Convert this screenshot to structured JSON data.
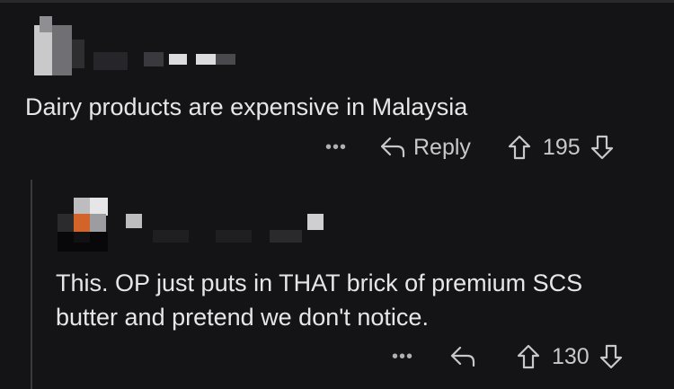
{
  "comment": {
    "body": "Dairy products are expensive in Malaysia",
    "more_label": "•••",
    "reply_label": "Reply",
    "score": "195",
    "icons": {
      "reply": "reply-arrow-icon",
      "upvote": "upvote-arrow-icon",
      "downvote": "downvote-arrow-icon"
    }
  },
  "reply": {
    "body": "This. OP just puts in THAT brick of premium SCS butter and pretend we don't notice.",
    "more_label": "•••",
    "score": "130",
    "icons": {
      "reply": "reply-arrow-icon",
      "upvote": "upvote-arrow-icon",
      "downvote": "downvote-arrow-icon"
    }
  },
  "colors": {
    "background": "#141416",
    "text": "#e6e6e8",
    "muted": "#b8b8bc",
    "thread_line": "#3a3a3e",
    "avatar_accent": "#d2642a"
  }
}
